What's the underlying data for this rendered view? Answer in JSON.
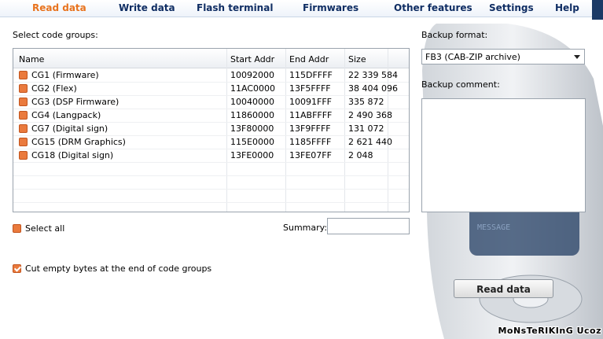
{
  "tabs": [
    {
      "label": "Read data",
      "active": true
    },
    {
      "label": "Write data",
      "active": false
    },
    {
      "label": "Flash terminal",
      "active": false
    },
    {
      "label": "Firmwares",
      "active": false
    },
    {
      "label": "Other features",
      "active": false
    },
    {
      "label": "Settings",
      "active": false
    },
    {
      "label": "Help",
      "active": false
    }
  ],
  "codegroups": {
    "label": "Select code groups:",
    "columns": [
      "Name",
      "Start Addr",
      "End Addr",
      "Size"
    ],
    "rows": [
      {
        "name": "CG1 (Firmware)",
        "start": "10092000",
        "end": "115DFFFF",
        "size": "22 339 584",
        "checked": false
      },
      {
        "name": "CG2 (Flex)",
        "start": "11AC0000",
        "end": "13F5FFFF",
        "size": "38 404 096",
        "checked": false
      },
      {
        "name": "CG3 (DSP Firmware)",
        "start": "10040000",
        "end": "10091FFF",
        "size": "335 872",
        "checked": false
      },
      {
        "name": "CG4 (Langpack)",
        "start": "11860000",
        "end": "11ABFFFF",
        "size": "2 490 368",
        "checked": false
      },
      {
        "name": "CG7 (Digital sign)",
        "start": "13F80000",
        "end": "13F9FFFF",
        "size": "131 072",
        "checked": false
      },
      {
        "name": "CG15 (DRM Graphics)",
        "start": "115E0000",
        "end": "1185FFFF",
        "size": "2 621 440",
        "checked": false
      },
      {
        "name": "CG18 (Digital sign)",
        "start": "13FE0000",
        "end": "13FE07FF",
        "size": "2 048",
        "checked": false
      }
    ]
  },
  "select_all": {
    "label": "Select all",
    "checked": false
  },
  "summary": {
    "label": "Summary:",
    "value": ""
  },
  "cut_empty": {
    "label": "Cut empty bytes at the end of code groups",
    "checked": true
  },
  "backup": {
    "format_label": "Backup format:",
    "format_value": "FB3 (CAB-ZIP archive)",
    "comment_label": "Backup comment:",
    "comment_value": ""
  },
  "read_button": "Read data",
  "phone_screen_text": "MESSAGE",
  "watermark": "MoNsTeRIKInG Ucoz",
  "colors": {
    "accent": "#e8731e",
    "tab_text": "#0f2d63",
    "checkbox": "#ea7a3d"
  }
}
